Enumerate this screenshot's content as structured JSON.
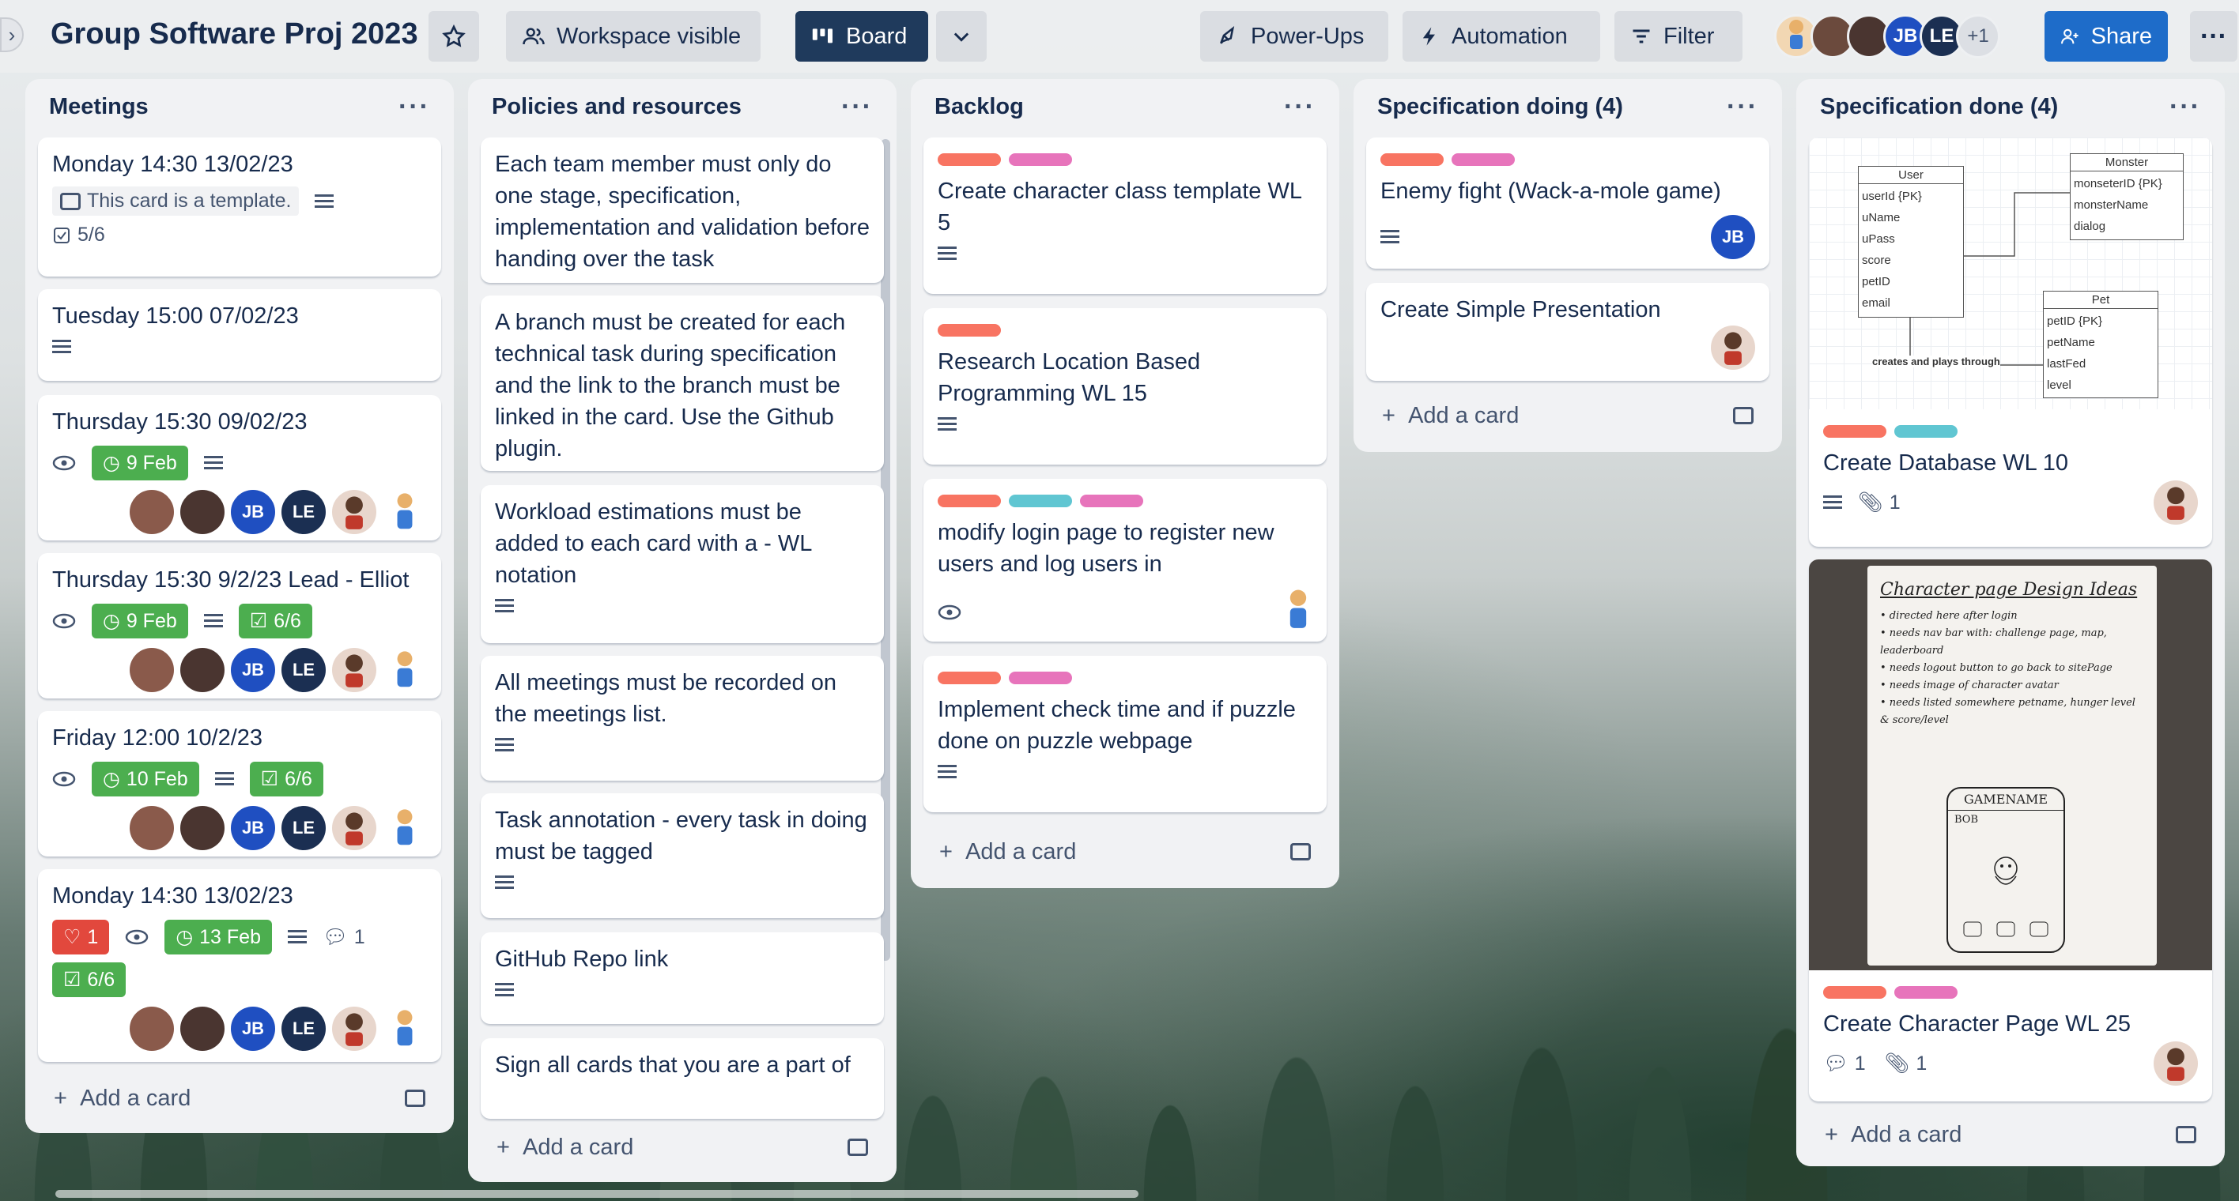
{
  "header": {
    "title": "Group Software Proj 2023",
    "visibility_label": "Workspace visible",
    "board_label": "Board",
    "powerups_label": "Power-Ups",
    "automation_label": "Automation",
    "filter_label": "Filter",
    "share_label": "Share",
    "members": [
      "JB",
      "LE"
    ],
    "extra_members": "+1"
  },
  "lists": {
    "meetings": {
      "title": "Meetings",
      "add_card": "Add a card",
      "cards": [
        {
          "title": "Monday 14:30 13/02/23",
          "template_text": "This card is a template.",
          "checklist": "5/6"
        },
        {
          "title": "Tuesday 15:00 07/02/23"
        },
        {
          "title": "Thursday 15:30 09/02/23",
          "due": "9 Feb"
        },
        {
          "title": "Thursday 15:30 9/2/23 Lead - Elliot",
          "due": "9 Feb",
          "checklist": "6/6"
        },
        {
          "title": "Friday 12:00 10/2/23",
          "due": "10 Feb",
          "checklist": "6/6"
        },
        {
          "title": "Monday 14:30 13/02/23",
          "votes": "1",
          "due": "13 Feb",
          "comments": "1",
          "checklist": "6/6"
        }
      ]
    },
    "policies": {
      "title": "Policies and resources",
      "add_card": "Add a card",
      "cards": [
        {
          "title": "Each team member must only do one stage, specification, implementation and validation before handing over the task"
        },
        {
          "title": "A branch must be created for each technical task during specification and the link to the branch must be linked in the card. Use the Github plugin."
        },
        {
          "title": "Workload estimations must be added to each card with a - WL notation"
        },
        {
          "title": "All meetings must be recorded on the meetings list."
        },
        {
          "title": "Task annotation - every task in doing must be tagged"
        },
        {
          "title": "GitHub Repo link"
        },
        {
          "title": "Sign all cards that you are a part of"
        }
      ]
    },
    "backlog": {
      "title": "Backlog",
      "add_card": "Add a card",
      "cards": [
        {
          "title": "Create character class template WL 5"
        },
        {
          "title": "Research Location Based Programming WL 15"
        },
        {
          "title": "modify login page to register new users and log users in"
        },
        {
          "title": "Implement check time and if puzzle done on puzzle webpage"
        }
      ]
    },
    "spec_doing": {
      "title": "Specification doing (4)",
      "add_card": "Add a card",
      "cards": [
        {
          "title": "Enemy fight (Wack-a-mole game)"
        },
        {
          "title": "Create Simple Presentation"
        }
      ]
    },
    "spec_done": {
      "title": "Specification done (4)",
      "add_card": "Add a card",
      "cards": [
        {
          "title": "Create Database WL 10",
          "attachments": "1"
        },
        {
          "title": "Create Character Page WL 25",
          "comments": "1",
          "attachments": "1"
        }
      ],
      "diagram": {
        "user": {
          "name": "User",
          "fields": [
            "userId {PK}",
            "uName",
            "uPass",
            "score",
            "petID",
            "email"
          ]
        },
        "monster": {
          "name": "Monster",
          "fields": [
            "monseterID {PK}",
            "monsterName",
            "dialog"
          ]
        },
        "pet": {
          "name": "Pet",
          "fields": [
            "petID {PK}",
            "petName",
            "lastFed",
            "level"
          ]
        },
        "relation": "creates and plays through"
      },
      "sketch": {
        "heading": "Character page Design Ideas",
        "notes": [
          "• directed here after login",
          "• needs nav bar with: challenge page, map, leaderboard",
          "• needs logout button to go back to sitePage",
          "• needs image of character avatar",
          "• needs listed somewhere petname, hunger level & score/level"
        ],
        "gamename": "GAMENAME",
        "bob": "BOB"
      }
    }
  },
  "colors": {
    "label_red": "#f87462",
    "label_pink": "#e774bb",
    "label_cyan": "#60c6d2",
    "green": "#4bce97",
    "jb": "#1f4fc1",
    "le": "#1b2f52",
    "share": "#1d7afc"
  }
}
